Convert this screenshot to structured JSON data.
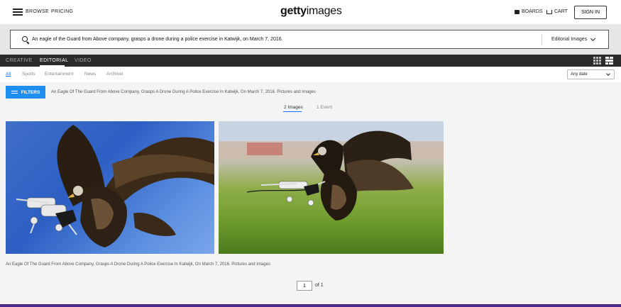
{
  "header": {
    "browse_label": "BROWSE",
    "pricing_label": "PRICING",
    "logo_bold": "getty",
    "logo_light": "images",
    "boards_label": "BOARDS",
    "cart_label": "CART",
    "signin_label": "SIGN IN"
  },
  "search": {
    "value": "An eagle of the Guard from Above company, grasps a drone during a police exercise in Katwijk, on March 7, 2016.",
    "scope": "Editorial Images"
  },
  "tabs": [
    {
      "label": "CREATIVE"
    },
    {
      "label": "EDITORIAL"
    },
    {
      "label": "VIDEO"
    }
  ],
  "subnav": [
    {
      "label": "All"
    },
    {
      "label": "Sports"
    },
    {
      "label": "Entertainment"
    },
    {
      "label": "News"
    },
    {
      "label": "Archival"
    }
  ],
  "date_filter": "Any date",
  "filters_label": "FILTERS",
  "results_heading": "An Eagle Of The Guard From Above Company, Grasps A Drone During A Police Exercise In Katwijk, On March 7, 2016. Pictures and Images",
  "result_tabs": [
    {
      "label": "2 Images"
    },
    {
      "label": "1 Event"
    }
  ],
  "caption": "An Eagle Of The Guard From Above Company, Grasps A Drone During A Police Exercise In Katwijk, On March 7, 2016. Pictures and Images",
  "pagination": {
    "current": "1",
    "of_label": "of 1"
  },
  "colors": {
    "accent": "#1f8ef1",
    "tabbar": "#2b2b2b",
    "bottom_bar": "#4b2a8c"
  }
}
